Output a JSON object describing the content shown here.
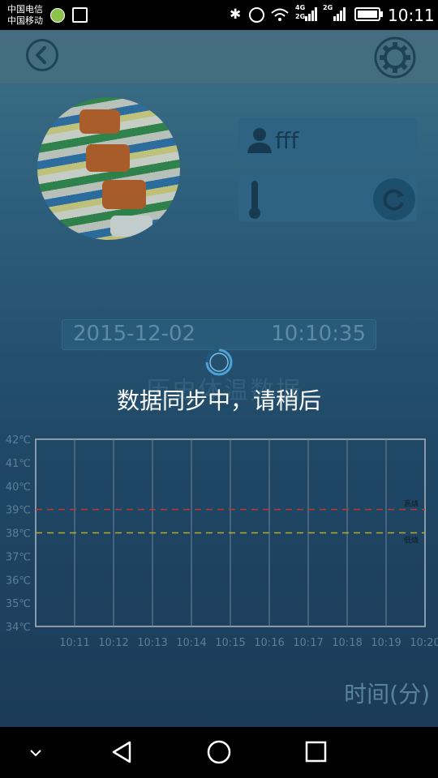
{
  "status_bar": {
    "carrier_1": "中国电信",
    "carrier_2": "中国移动",
    "network_1": "4G",
    "network_2": "2G",
    "network_3": "2G",
    "time": "10:11"
  },
  "profile": {
    "name": "fff",
    "temperature": ""
  },
  "reading": {
    "date": "2015-12-02",
    "time": "10:10:35"
  },
  "section_title": "历史体温数据",
  "loading_message": "数据同步中，请稍后",
  "chart_data": {
    "type": "line",
    "ylim": [
      34,
      42
    ],
    "y_ticks": [
      "42℃",
      "41℃",
      "40℃",
      "39℃",
      "38℃",
      "37℃",
      "36℃",
      "35℃",
      "34℃"
    ],
    "x_ticks": [
      "10:11",
      "10:12",
      "10:13",
      "10:14",
      "10:15",
      "10:16",
      "10:17",
      "10:18",
      "10:19",
      "10:20"
    ],
    "xlabel": "时间(分)",
    "thresholds": [
      {
        "name": "高烧",
        "value": 39,
        "color": "#c0392b"
      },
      {
        "name": "低烧",
        "value": 38,
        "color": "#b5a82a"
      }
    ],
    "series": []
  },
  "colors": {
    "accent": "#4da3d6",
    "high_fever": "#c0392b",
    "low_fever": "#b5a82a"
  }
}
